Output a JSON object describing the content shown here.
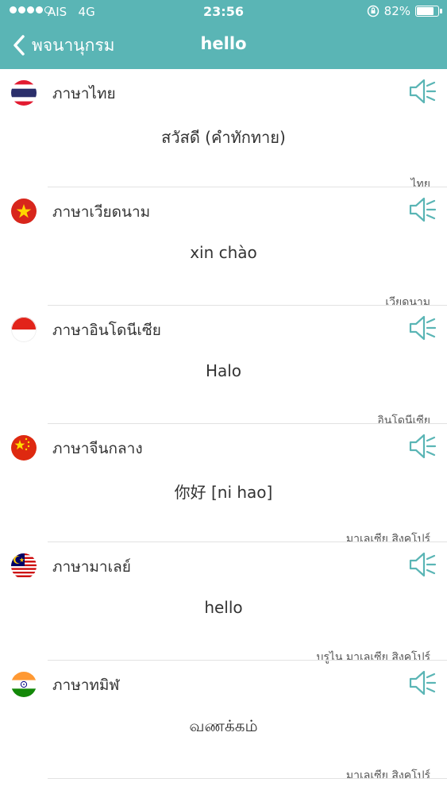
{
  "status_bar": {
    "carrier": "AIS",
    "network": "4G",
    "time": "23:56",
    "battery": "82%",
    "battery_level": 0.82,
    "signal_bars": 4
  },
  "nav": {
    "back_label": "พจนานุกรม",
    "title": "hello"
  },
  "colors": {
    "header_bg": "#5ab5b5",
    "speaker": "#5ab5b5"
  },
  "entries": [
    {
      "flag": "thailand-flag-icon",
      "language": "ภาษาไทย",
      "translation": "สวัสดี (คำทักทาย)",
      "region": "ไทย"
    },
    {
      "flag": "vietnam-flag-icon",
      "language": "ภาษาเวียดนาม",
      "translation": "xin chào",
      "region": "เวียดนาม"
    },
    {
      "flag": "indonesia-flag-icon",
      "language": "ภาษาอินโดนีเซีย",
      "translation": "Halo",
      "region": "อินโดนีเซีย"
    },
    {
      "flag": "china-flag-icon",
      "language": "ภาษาจีนกลาง",
      "translation": "你好 [ni hao]",
      "region": "มาเลเซีย สิงคโปร์"
    },
    {
      "flag": "malaysia-flag-icon",
      "language": "ภาษามาเลย์",
      "translation": "hello",
      "region": "บรูไน มาเลเซีย สิงคโปร์"
    },
    {
      "flag": "india-flag-icon",
      "language": "ภาษาทมิฬ",
      "translation": "வணக்கம்",
      "region": "มาเลเซีย สิงคโปร์"
    }
  ]
}
